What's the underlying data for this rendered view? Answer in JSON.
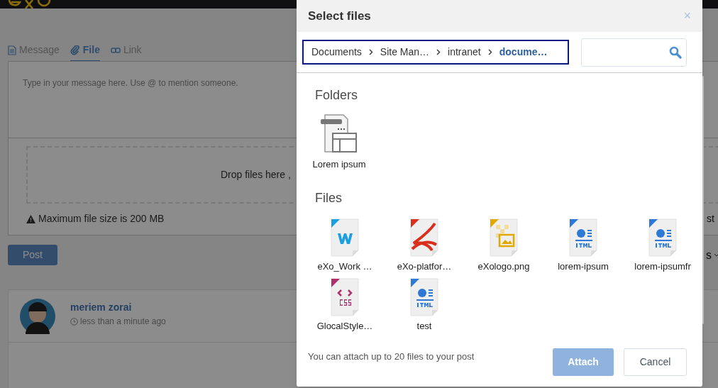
{
  "composer": {
    "tabs": [
      {
        "label": "Message",
        "selected": false
      },
      {
        "label": "File",
        "selected": true
      },
      {
        "label": "Link",
        "selected": false
      }
    ],
    "placeholder": "Type in your message here. Use @ to mention someone.",
    "drop_text": "Drop files here ,",
    "max_size": "Maximum file size is 200 MB",
    "right_fragment": "st",
    "post_button": "Post",
    "filter_fragment": "s"
  },
  "activity": {
    "author": "meriem zorai",
    "time": "less than a minute ago"
  },
  "dialog": {
    "title": "Select files",
    "close": "×",
    "breadcrumb": [
      {
        "label": "Documents",
        "selected": false
      },
      {
        "label": "Site Man…",
        "selected": false
      },
      {
        "label": "intranet",
        "selected": false
      },
      {
        "label": "docume…",
        "selected": true
      }
    ],
    "folders_heading": "Folders",
    "folders": [
      {
        "name": "Lorem ipsum"
      }
    ],
    "files_heading": "Files",
    "files": [
      {
        "name": "eXo_Work …",
        "kind": "word"
      },
      {
        "name": "eXo-platfor…",
        "kind": "pdf"
      },
      {
        "name": "eXologo.png",
        "kind": "image"
      },
      {
        "name": "lorem-ipsum",
        "kind": "html"
      },
      {
        "name": "lorem-ipsumfr",
        "kind": "html"
      },
      {
        "name": "GlocalStyle…",
        "kind": "css"
      },
      {
        "name": "test",
        "kind": "html"
      }
    ],
    "hint": "You can attach up to 20 files to your post",
    "attach_button": "Attach",
    "cancel_button": "Cancel"
  }
}
